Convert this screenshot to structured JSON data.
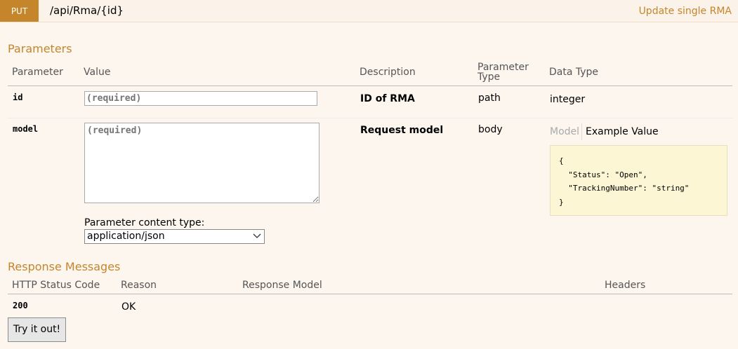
{
  "operation": {
    "method": "PUT",
    "path": "/api/Rma/{id}",
    "summary": "Update single RMA"
  },
  "parameters": {
    "title": "Parameters",
    "columns": {
      "parameter": "Parameter",
      "value": "Value",
      "description": "Description",
      "parameter_type": "Parameter Type",
      "data_type": "Data Type"
    },
    "rows": [
      {
        "name": "id",
        "placeholder": "(required)",
        "description": "ID of RMA",
        "param_type": "path",
        "data_type": "integer"
      },
      {
        "name": "model",
        "placeholder": "(required)",
        "description": "Request model",
        "param_type": "body",
        "content_type_label": "Parameter content type:",
        "content_type_value": "application/json",
        "model_tab": "Model",
        "example_tab": "Example Value",
        "example_json": "{\n  \"Status\": \"Open\",\n  \"TrackingNumber\": \"string\"\n}"
      }
    ]
  },
  "responses": {
    "title": "Response Messages",
    "columns": {
      "status": "HTTP Status Code",
      "reason": "Reason",
      "model": "Response Model",
      "headers": "Headers"
    },
    "rows": [
      {
        "status": "200",
        "reason": "OK"
      }
    ]
  },
  "try_button": "Try it out!",
  "colors": {
    "accent": "#c5862b",
    "background": "#fcf6ef",
    "sample_bg": "#fcf6d5"
  }
}
